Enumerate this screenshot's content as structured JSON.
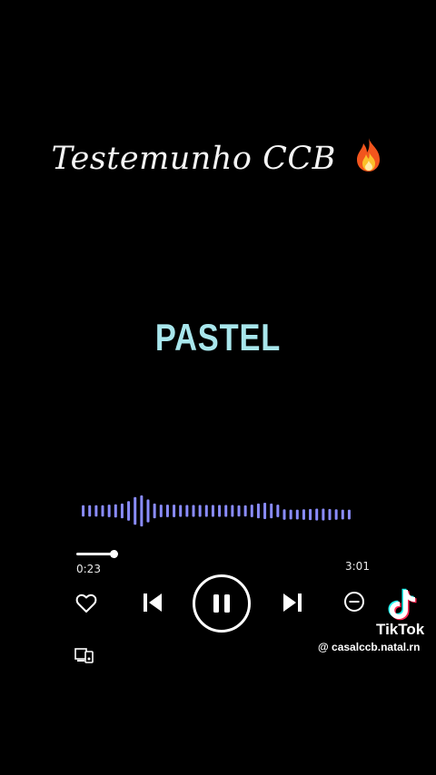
{
  "header": {
    "title": "Testemunho CCB",
    "title_icon": "fire-icon"
  },
  "song": {
    "name": "PASTEL"
  },
  "waveform": {
    "color": "#8a8cff",
    "levels": [
      0.35,
      0.35,
      0.35,
      0.35,
      0.38,
      0.4,
      0.45,
      0.6,
      0.85,
      0.95,
      0.7,
      0.45,
      0.38,
      0.38,
      0.38,
      0.36,
      0.36,
      0.36,
      0.36,
      0.36,
      0.36,
      0.36,
      0.36,
      0.36,
      0.34,
      0.34,
      0.38,
      0.45,
      0.5,
      0.45,
      0.38,
      0.32,
      0.3,
      0.3,
      0.32,
      0.34,
      0.36,
      0.36,
      0.34,
      0.32,
      0.3,
      0.3
    ]
  },
  "player": {
    "elapsed": "0:23",
    "total": "3:01",
    "progress": 0.127,
    "state": "playing",
    "controls": {
      "like_icon": "heart-icon",
      "prev_icon": "skip-previous-icon",
      "pause_icon": "pause-icon",
      "next_icon": "skip-next-icon",
      "remove_icon": "minus-circle-icon",
      "device_icon": "devices-icon"
    }
  },
  "watermark": {
    "brand": "TikTok",
    "handle": "@ casalccb.natal.rn",
    "logo_icon": "tiktok-logo-icon"
  }
}
